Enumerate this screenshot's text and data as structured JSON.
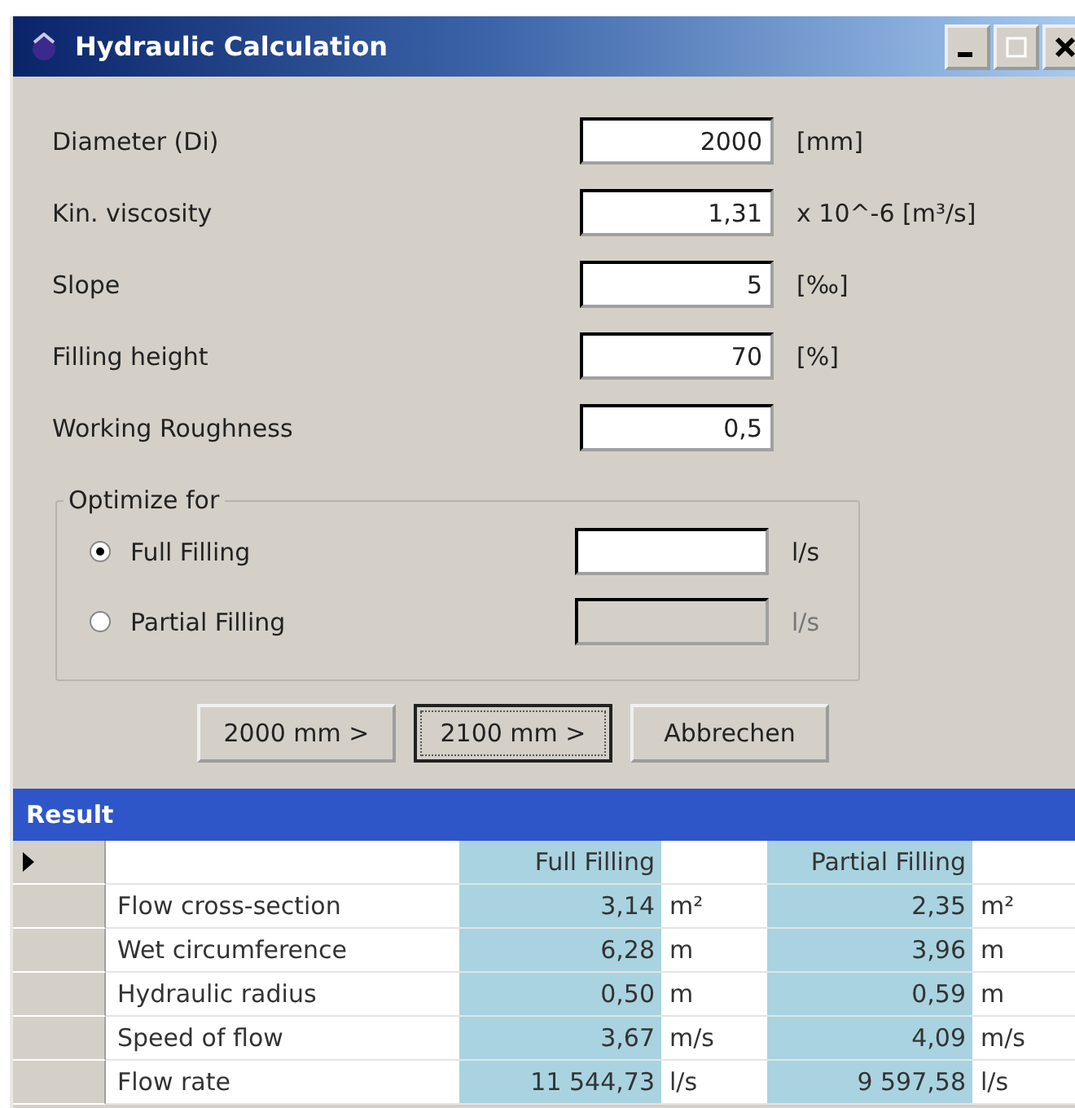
{
  "window": {
    "title": "Hydraulic Calculation"
  },
  "fields": [
    {
      "label": "Diameter (Di)",
      "value": "2000",
      "unit": "[mm]"
    },
    {
      "label": "Kin. viscosity",
      "value": "1,31",
      "unit": "x 10^-6 [m³/s]"
    },
    {
      "label": "Slope",
      "value": "5",
      "unit": "[‰]"
    },
    {
      "label": "Filling height",
      "value": "70",
      "unit": "[%]"
    },
    {
      "label": "Working Roughness",
      "value": "0,5"
    }
  ],
  "optimize": {
    "title": "Optimize for",
    "options": [
      {
        "label": "Full Filling",
        "selected": true,
        "disabled": false,
        "unit": "l/s"
      },
      {
        "label": "Partial Filling",
        "selected": false,
        "disabled": true,
        "unit": "l/s"
      }
    ]
  },
  "buttons": [
    {
      "label": "2000 mm >",
      "focused": false
    },
    {
      "label": "2100 mm >",
      "focused": true
    },
    {
      "label": "Abbrechen",
      "focused": false
    }
  ],
  "result": {
    "title": "Result",
    "rows": [
      {
        "current": true,
        "full": "Full Filling",
        "partial": "Partial Filling"
      },
      {
        "current": false,
        "name": "Flow cross-section",
        "full": "3,14",
        "full_unit": "m²",
        "partial": "2,35",
        "partial_unit": "m²"
      },
      {
        "current": false,
        "name": "Wet circumference",
        "full": "6,28",
        "full_unit": "m",
        "partial": "3,96",
        "partial_unit": "m"
      },
      {
        "current": false,
        "name": "Hydraulic radius",
        "full": "0,50",
        "full_unit": "m",
        "partial": "0,59",
        "partial_unit": "m"
      },
      {
        "current": false,
        "name": "Speed of flow",
        "full": "3,67",
        "full_unit": "m/s",
        "partial": "4,09",
        "partial_unit": "m/s"
      },
      {
        "current": false,
        "name": "Flow rate",
        "full": "11 544,73",
        "full_unit": "l/s",
        "partial": "9 597,58",
        "partial_unit": "l/s"
      }
    ]
  }
}
